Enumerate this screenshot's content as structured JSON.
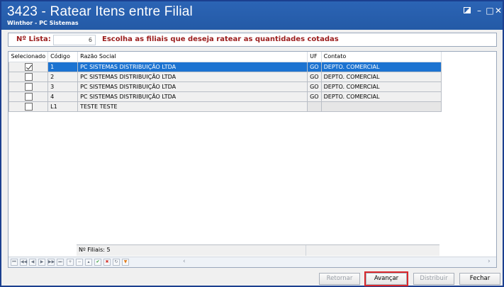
{
  "window": {
    "title": "3423 - Ratear Itens entre Filial",
    "subtitle": "Winthor - PC Sistemas"
  },
  "header": {
    "lista_label": "Nº Lista:",
    "lista_value": "6",
    "message": "Escolha as filiais que deseja ratear as quantidades cotadas"
  },
  "grid": {
    "columns": [
      "Selecionado",
      "Código",
      "Razão Social",
      "UF",
      "Contato"
    ],
    "rows": [
      {
        "selected": true,
        "codigo": "1",
        "razao": "PC SISTEMAS DISTRIBUIÇÃO LTDA",
        "uf": "GO",
        "contato": "DEPTO. COMERCIAL"
      },
      {
        "selected": false,
        "codigo": "2",
        "razao": "PC SISTEMAS DISTRIBUIÇÃO LTDA",
        "uf": "GO",
        "contato": "DEPTO. COMERCIAL"
      },
      {
        "selected": false,
        "codigo": "3",
        "razao": "PC SISTEMAS DISTRIBUIÇÃO LTDA",
        "uf": "GO",
        "contato": "DEPTO. COMERCIAL"
      },
      {
        "selected": false,
        "codigo": "4",
        "razao": "PC SISTEMAS DISTRIBUIÇÃO LTDA",
        "uf": "GO",
        "contato": "DEPTO. COMERCIAL"
      },
      {
        "selected": false,
        "codigo": "L1",
        "razao": "TESTE TESTE",
        "uf": "",
        "contato": ""
      }
    ],
    "footer": "Nº Filiais: 5"
  },
  "buttons": {
    "retornar": "Retornar",
    "avancar": "Avançar",
    "distribuir": "Distribuir",
    "fechar": "Fechar"
  }
}
